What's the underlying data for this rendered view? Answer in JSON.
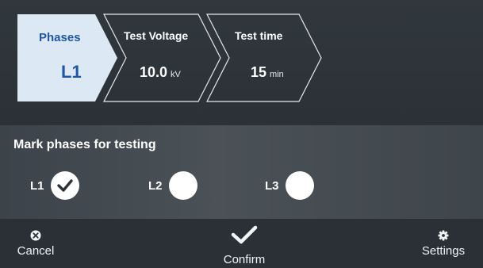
{
  "steps": [
    {
      "title": "Phases",
      "value": "L1",
      "unit": "",
      "active": true
    },
    {
      "title": "Test Voltage",
      "value": "10.0",
      "unit": "kV",
      "active": false
    },
    {
      "title": "Test time",
      "value": "15",
      "unit": "min",
      "active": false
    }
  ],
  "panel": {
    "title": "Mark phases for testing",
    "phases": [
      {
        "label": "L1",
        "checked": true
      },
      {
        "label": "L2",
        "checked": false
      },
      {
        "label": "L3",
        "checked": false
      }
    ]
  },
  "footer": {
    "cancel_label": "Cancel",
    "confirm_label": "Confirm",
    "settings_label": "Settings"
  },
  "colors": {
    "background": "#2c3238",
    "active_step_bg": "#dce8f3",
    "active_text": "#1f57a8",
    "panel": "#464d53"
  },
  "icons": {
    "cancel": "close-circle-icon",
    "confirm": "checkmark-icon",
    "settings": "gear-icon",
    "phase_check": "check-icon"
  }
}
